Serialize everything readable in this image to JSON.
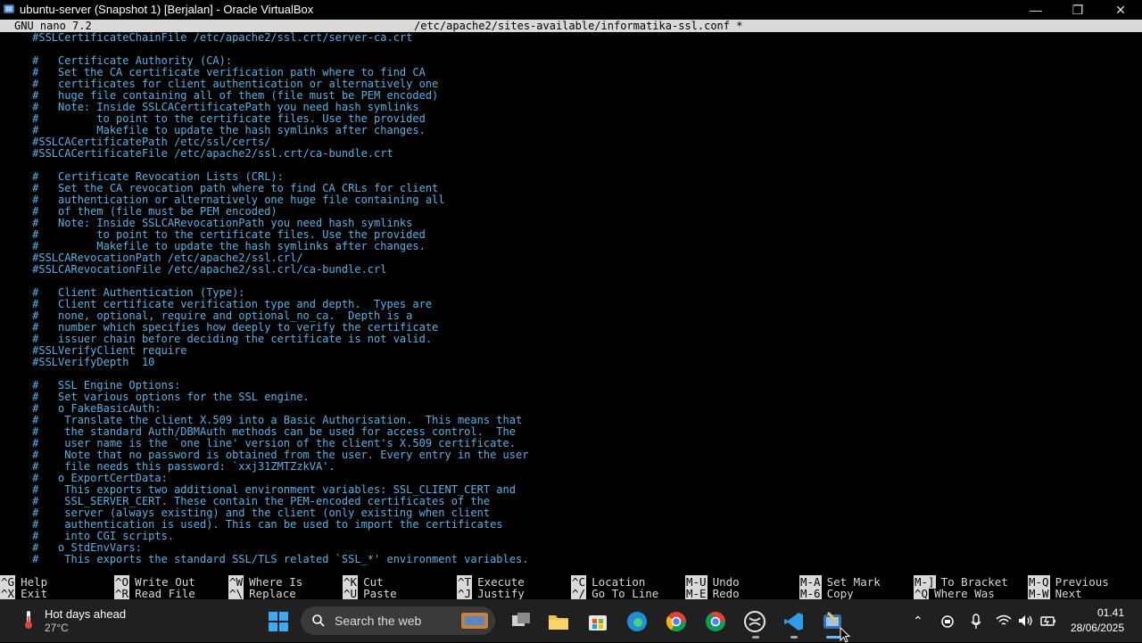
{
  "window": {
    "title": "ubuntu-server (Snapshot 1) [Berjalan] - Oracle VirtualBox",
    "minimize_glyph": "—",
    "maximize_glyph": "❐",
    "close_glyph": "✕"
  },
  "nano": {
    "version": "GNU nano 7.2",
    "filename": "/etc/apache2/sites-available/informatika-ssl.conf *"
  },
  "editor": {
    "lines": [
      "     #SSLCertificateChainFile /etc/apache2/ssl.crt/server-ca.crt",
      "",
      "     #   Certificate Authority (CA):",
      "     #   Set the CA certificate verification path where to find CA",
      "     #   certificates for client authentication or alternatively one",
      "     #   huge file containing all of them (file must be PEM encoded)",
      "     #   Note: Inside SSLCACertificatePath you need hash symlinks",
      "     #         to point to the certificate files. Use the provided",
      "     #         Makefile to update the hash symlinks after changes.",
      "     #SSLCACertificatePath /etc/ssl/certs/",
      "     #SSLCACertificateFile /etc/apache2/ssl.crt/ca-bundle.crt",
      "",
      "     #   Certificate Revocation Lists (CRL):",
      "     #   Set the CA revocation path where to find CA CRLs for client",
      "     #   authentication or alternatively one huge file containing all",
      "     #   of them (file must be PEM encoded)",
      "     #   Note: Inside SSLCARevocationPath you need hash symlinks",
      "     #         to point to the certificate files. Use the provided",
      "     #         Makefile to update the hash symlinks after changes.",
      "     #SSLCARevocationPath /etc/apache2/ssl.crl/",
      "     #SSLCARevocationFile /etc/apache2/ssl.crl/ca-bundle.crl",
      "",
      "     #   Client Authentication (Type):",
      "     #   Client certificate verification type and depth.  Types are",
      "     #   none, optional, require and optional_no_ca.  Depth is a",
      "     #   number which specifies how deeply to verify the certificate",
      "     #   issuer chain before deciding the certificate is not valid.",
      "     #SSLVerifyClient require",
      "     #SSLVerifyDepth  10",
      "",
      "     #   SSL Engine Options:",
      "     #   Set various options for the SSL engine.",
      "     #   o FakeBasicAuth:",
      "     #    Translate the client X.509 into a Basic Authorisation.  This means that",
      "     #    the standard Auth/DBMAuth methods can be used for access control.  The",
      "     #    user name is the `one line' version of the client's X.509 certificate.",
      "     #    Note that no password is obtained from the user. Every entry in the user",
      "     #    file needs this password: `xxj31ZMTZzkVA'.",
      "     #   o ExportCertData:",
      "     #    This exports two additional environment variables: SSL_CLIENT_CERT and",
      "     #    SSL_SERVER_CERT. These contain the PEM-encoded certificates of the",
      "     #    server (always existing) and the client (only existing when client",
      "     #    authentication is used). This can be used to import the certificates",
      "     #    into CGI scripts.",
      "     #   o StdEnvVars:",
      "     #    This exports the standard SSL/TLS related `SSL_*' environment variables."
    ]
  },
  "shortcuts": [
    {
      "top_key": "^G",
      "top_label": "Help",
      "bottom_key": "^X",
      "bottom_label": "Exit"
    },
    {
      "top_key": "^O",
      "top_label": "Write Out",
      "bottom_key": "^R",
      "bottom_label": "Read File"
    },
    {
      "top_key": "^W",
      "top_label": "Where Is",
      "bottom_key": "^\\",
      "bottom_label": "Replace"
    },
    {
      "top_key": "^K",
      "top_label": "Cut",
      "bottom_key": "^U",
      "bottom_label": "Paste"
    },
    {
      "top_key": "^T",
      "top_label": "Execute",
      "bottom_key": "^J",
      "bottom_label": "Justify"
    },
    {
      "top_key": "^C",
      "top_label": "Location",
      "bottom_key": "^/",
      "bottom_label": "Go To Line"
    },
    {
      "top_key": "M-U",
      "top_label": "Undo",
      "bottom_key": "M-E",
      "bottom_label": "Redo"
    },
    {
      "top_key": "M-A",
      "top_label": "Set Mark",
      "bottom_key": "M-6",
      "bottom_label": "Copy"
    },
    {
      "top_key": "M-]",
      "top_label": "To Bracket",
      "bottom_key": "^Q",
      "bottom_label": "Where Was"
    },
    {
      "top_key": "M-Q",
      "top_label": "Previous",
      "bottom_key": "M-W",
      "bottom_label": "Next"
    }
  ],
  "taskbar": {
    "weather_title": "Hot days ahead",
    "weather_temp": "27°C",
    "search_placeholder": "Search the web",
    "tray_chevron": "⌃",
    "time": "01.41",
    "date": "28/06/2025"
  },
  "colors": {
    "editor_text": "#5ab0e4",
    "header_bg": "#d9d9d9",
    "taskbar_bg": "#202020"
  }
}
